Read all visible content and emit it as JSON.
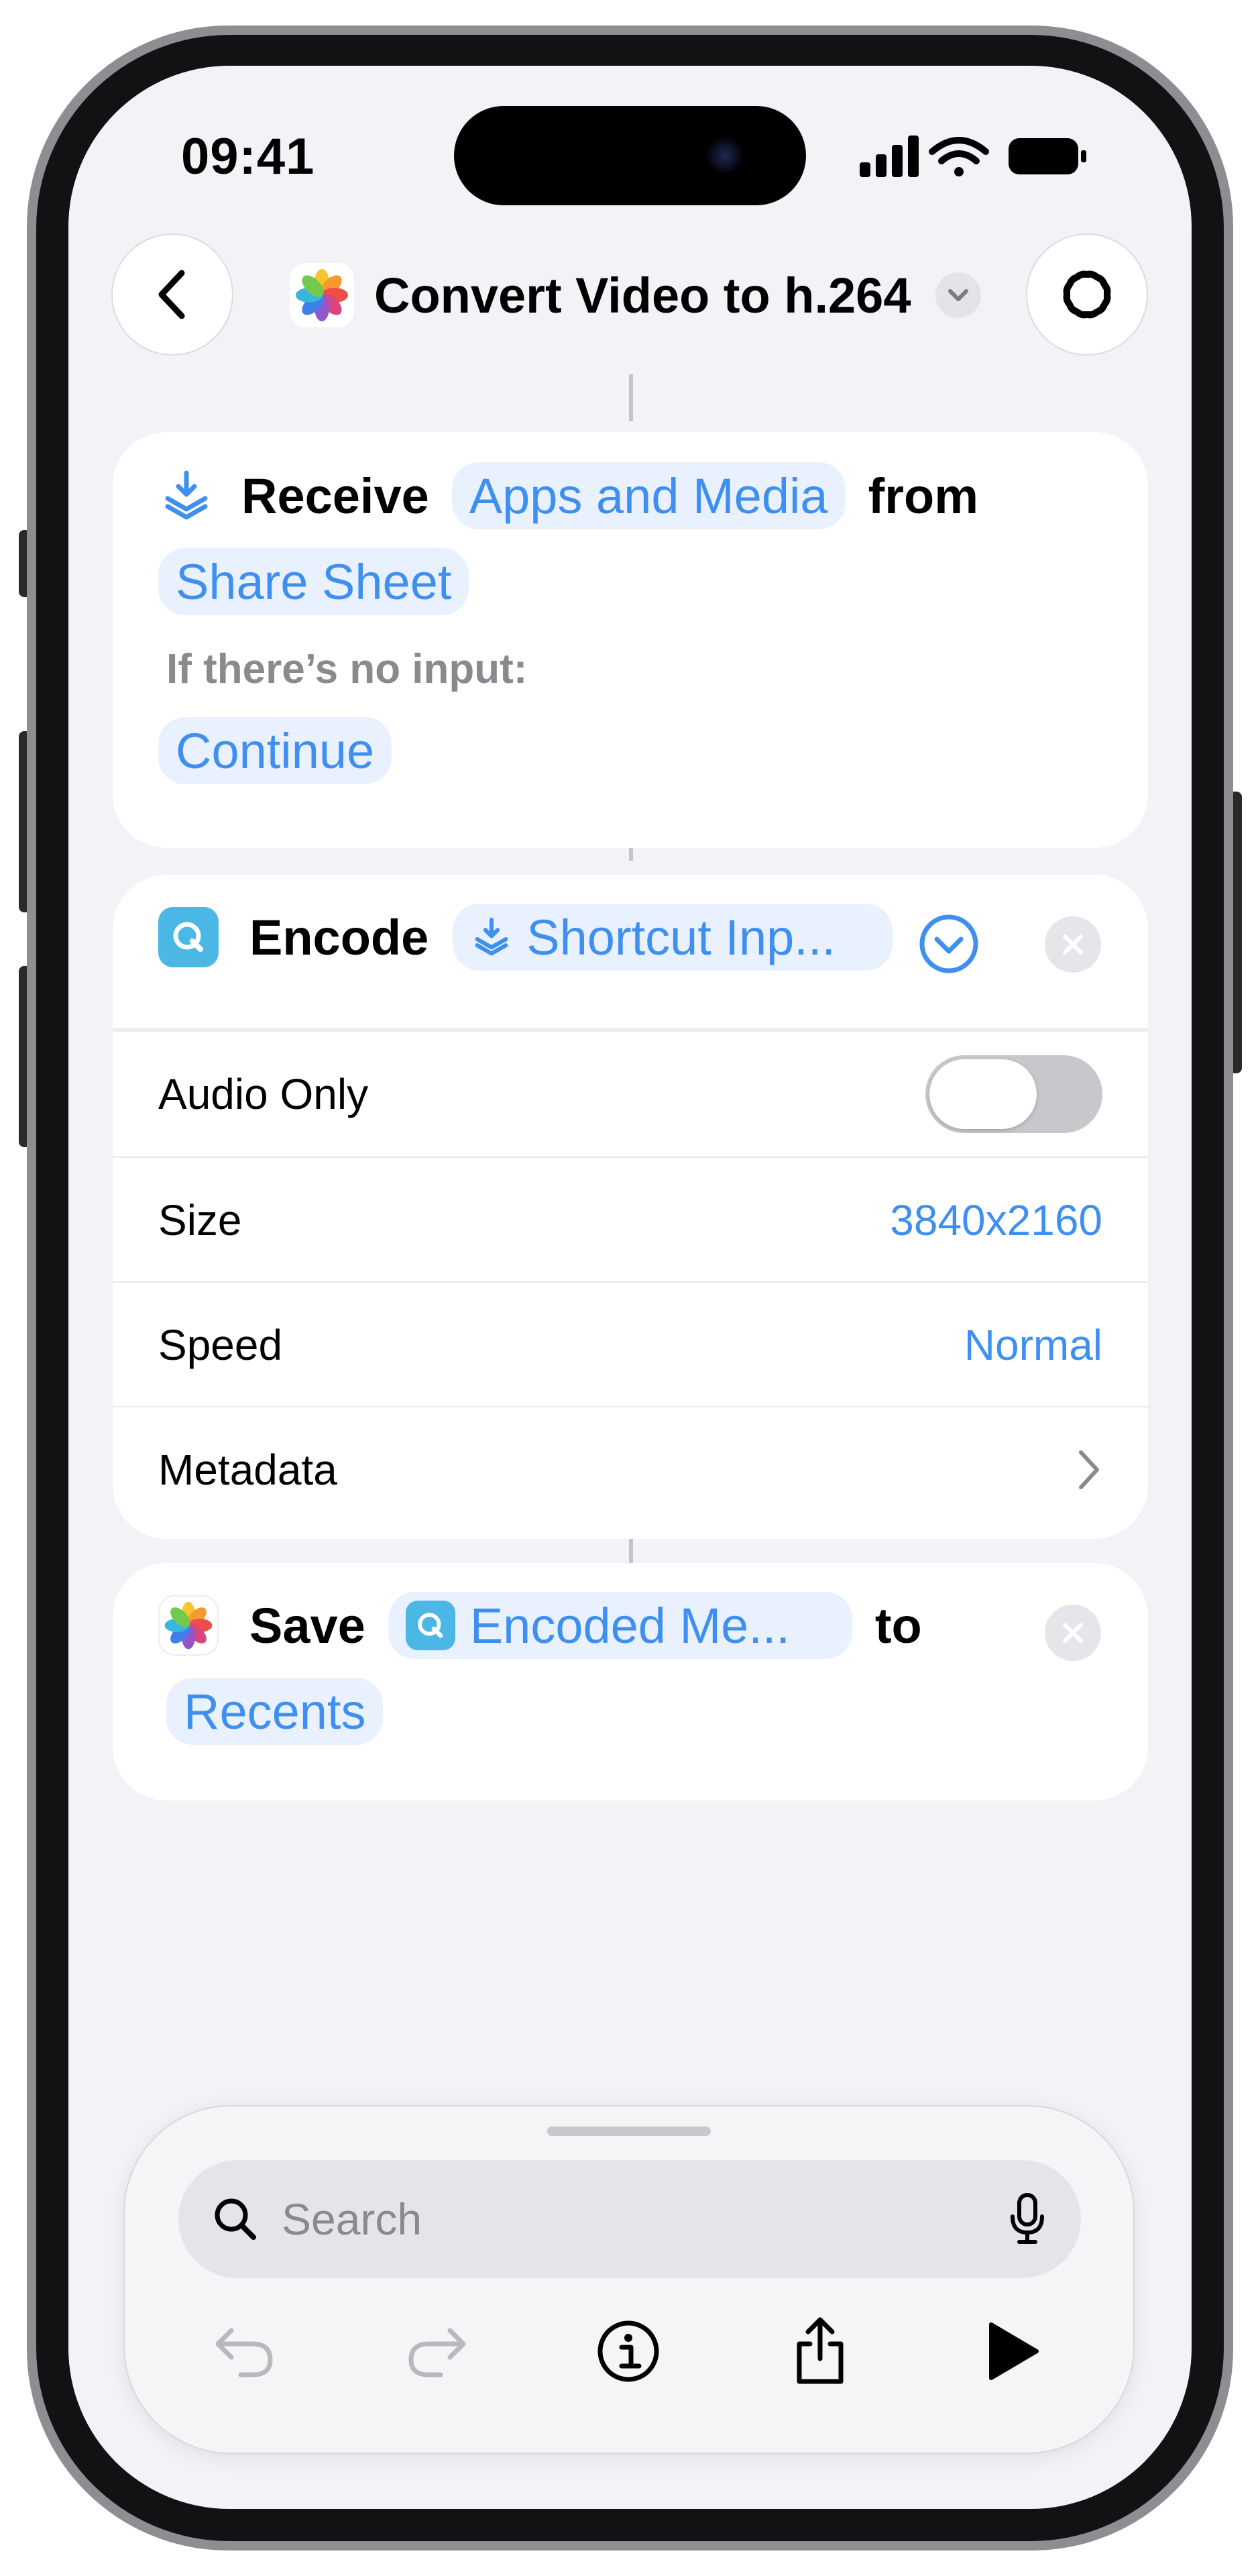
{
  "status_bar": {
    "time": "09:41",
    "icons": [
      "signal-icon",
      "wifi-icon",
      "battery-icon"
    ]
  },
  "nav": {
    "back_icon": "chevron-left-icon",
    "title": "Convert Video to h.264",
    "menu_icon": "chevron-down-icon",
    "settings_icon": "ai-flower-icon"
  },
  "receive_card": {
    "verb": "Receive",
    "input_types": "Apps and Media",
    "from_word": "from",
    "source": "Share Sheet",
    "no_input_label": "If there’s no input:",
    "no_input_action": "Continue"
  },
  "encode_card": {
    "verb": "Encode",
    "input": "Shortcut Inp...",
    "rows": {
      "audio_only": {
        "label": "Audio Only",
        "on": false
      },
      "size": {
        "label": "Size",
        "value": "3840x2160"
      },
      "speed": {
        "label": "Speed",
        "value": "Normal"
      },
      "metadata": {
        "label": "Metadata"
      }
    }
  },
  "save_card": {
    "verb": "Save",
    "input": "Encoded Me...",
    "to_word": "to",
    "destination": "Recents"
  },
  "bottom_bar": {
    "search_placeholder": "Search",
    "tools": [
      "undo-icon",
      "redo-icon",
      "info-icon",
      "share-icon",
      "play-icon"
    ]
  },
  "colors": {
    "accent": "#3f8ff0",
    "pill_bg": "#e8f1fd",
    "screen_bg": "#f2f2f7",
    "quicktime_icon": "#4bb7e5"
  }
}
